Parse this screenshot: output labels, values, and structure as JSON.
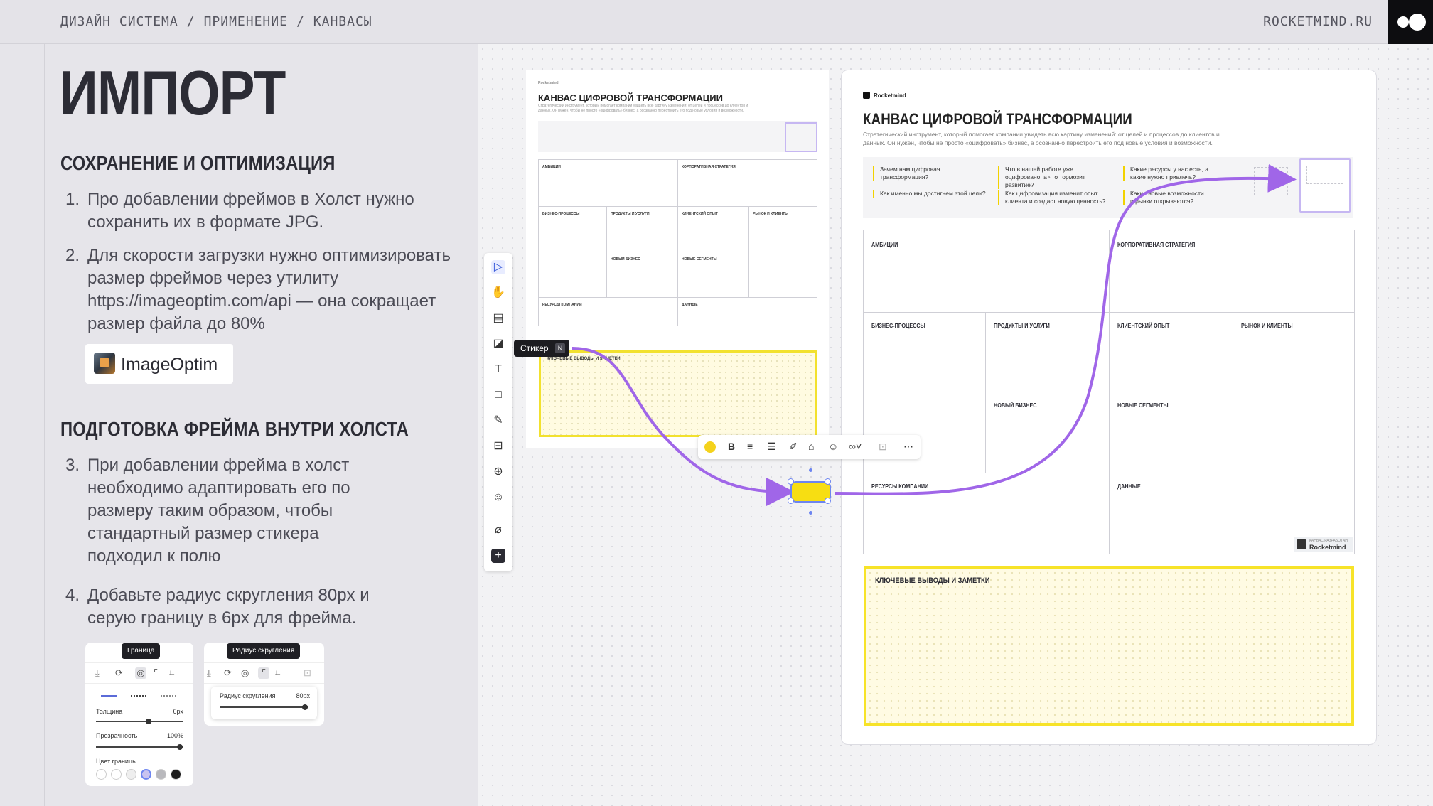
{
  "header": {
    "breadcrumb": [
      "ДИЗАЙН СИСТЕМА",
      "ПРИМЕНЕНИЕ",
      "КАНВАСЫ"
    ],
    "breadcrumb_sep": "/",
    "site": "ROCKETMIND.RU"
  },
  "left": {
    "title": "ИМПОРТ",
    "section1": "СОХРАНЕНИЕ И ОПТИМИЗАЦИЯ",
    "section2": "ПОДГОТОВКА ФРЕЙМА ВНУТРИ ХОЛСТА",
    "items": [
      {
        "num": "1.",
        "text": "Про добавлении фреймов в Холст нужно сохранить их в формате JPG."
      },
      {
        "num": "2.",
        "text": "Для скорости загрузки нужно оптимизировать размер фреймов через утилиту https://imageoptim.com/api — она сокращает размер файла до 80%"
      },
      {
        "num": "3.",
        "text": "При добавлении фрейма в холст необходимо адаптировать его по размеру таким образом, чтобы стандартный размер стикера подходил к полю"
      },
      {
        "num": "4.",
        "text": "Добавьте радиус скругления 80px и серую границу в 6px для фрейма."
      }
    ],
    "app_button": "ImageOptim",
    "shot_border": {
      "tooltip": "Граница",
      "thickness_label": "Толщина",
      "thickness_value": "6px",
      "opacity_label": "Прозрачность",
      "opacity_value": "100%",
      "color_label": "Цвет границы",
      "swatches": [
        "#ffffff",
        "#ffffff",
        "#eeeeee",
        "#c9c3f0",
        "#b9b9bd",
        "#1c1c1c"
      ]
    },
    "shot_radius": {
      "tooltip": "Радиус скругления",
      "radius_label": "Радиус скругления",
      "radius_value": "80px"
    }
  },
  "canvas_small": {
    "brand": "Rocketmind",
    "title": "КАНВАС ЦИФРОВОЙ ТРАНСФОРМАЦИИ",
    "cells": [
      "АМБИЦИИ",
      "КОРПОРАТИВНАЯ СТРАТЕГИЯ",
      "БИЗНЕС-ПРОЦЕССЫ",
      "ПРОДУКТЫ И УСЛУГИ",
      "КЛИЕНТСКИЙ ОПЫТ",
      "РЫНОК И КЛИЕНТЫ",
      "НОВЫЙ БИЗНЕС",
      "НОВЫЕ СЕГМЕНТЫ",
      "РЕСУРСЫ КОМПАНИИ",
      "ДАННЫЕ"
    ],
    "notes": "КЛЮЧЕВЫЕ ВЫВОДЫ И ЗАМЕТКИ"
  },
  "canvas_big": {
    "brand": "Rocketmind",
    "title": "КАНВАС ЦИФРОВОЙ ТРАНСФОРМАЦИИ",
    "description": "Стратегический инструмент, который помогает компании увидеть всю картину изменений: от целей и процессов до клиентов и данных. Он нужен, чтобы не просто «оцифровать» бизнес, а осознанно перестроить его под новые условия и возможности.",
    "questions": [
      "Зачем нам цифровая трансформация?",
      "Как именно мы достигнем этой цели?",
      "Что в нашей работе уже оцифровано, а что тормозит развитие?",
      "Как цифровизация изменит опыт клиента и создаст новую ценность?",
      "Какие ресурсы у нас есть, а какие нужно привлечь?",
      "Какие новые возможности и рынки открываются?"
    ],
    "cells": {
      "ambitions": "АМБИЦИИ",
      "strategy": "КОРПОРАТИВНАЯ СТРАТЕГИЯ",
      "processes": "БИЗНЕС-ПРОЦЕССЫ",
      "products": "ПРОДУКТЫ И УСЛУГИ",
      "cx": "КЛИЕНТСКИЙ ОПЫТ",
      "market": "РЫНОК И КЛИЕНТЫ",
      "new_business": "НОВЫЙ БИЗНЕС",
      "new_segments": "НОВЫЕ СЕГМЕНТЫ",
      "resources": "РЕСУРСЫ КОМПАНИИ",
      "data": "ДАННЫЕ"
    },
    "notes": "КЛЮЧЕВЫЕ ВЫВОДЫ И ЗАМЕТКИ",
    "badge_small": "КАНВАС РАЗРАБОТАН",
    "badge_brand": "Rocketmind"
  },
  "toolbar": {
    "sticker_tooltip": "Стикер",
    "sticker_key": "N"
  },
  "colors": {
    "accent_purple": "#a066e8",
    "sticker_yellow": "#f7de12",
    "selection_blue": "#6d85f0"
  }
}
